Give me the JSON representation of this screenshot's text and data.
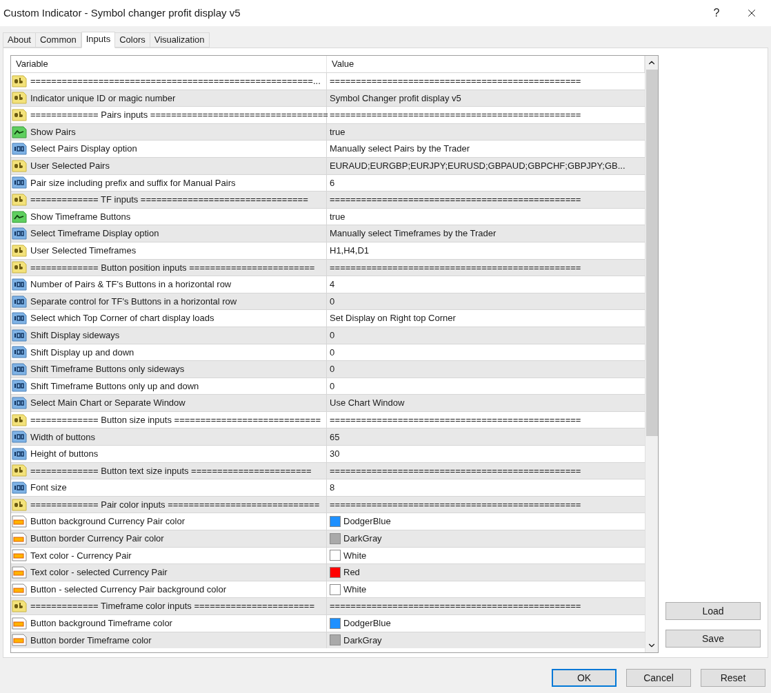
{
  "window": {
    "title": "Custom Indicator - Symbol changer profit display v5",
    "help": "?"
  },
  "tabs": [
    {
      "label": "About",
      "selected": false
    },
    {
      "label": "Common",
      "selected": false
    },
    {
      "label": "Inputs",
      "selected": true
    },
    {
      "label": "Colors",
      "selected": false
    },
    {
      "label": "Visualization",
      "selected": false
    }
  ],
  "table": {
    "columns": [
      "Variable",
      "Value"
    ],
    "rows": [
      {
        "kind": "string",
        "variable": "======================================================...",
        "value": "================================================"
      },
      {
        "kind": "string",
        "variable": "Indicator unique ID or magic number",
        "value": "Symbol Changer profit display v5"
      },
      {
        "kind": "string",
        "variable": "============= Pairs inputs ==================================",
        "value": "================================================"
      },
      {
        "kind": "bool",
        "variable": "Show Pairs",
        "value": "true"
      },
      {
        "kind": "int",
        "variable": "Select Pairs Display option",
        "value": "Manually select Pairs by the Trader"
      },
      {
        "kind": "string",
        "variable": "User Selected Pairs",
        "value": "EURAUD;EURGBP;EURJPY;EURUSD;GBPAUD;GBPCHF;GBPJPY;GB..."
      },
      {
        "kind": "int",
        "variable": "Pair size including prefix and suffix for Manual Pairs",
        "value": "6"
      },
      {
        "kind": "string",
        "variable": "============= TF inputs ================================",
        "value": "================================================"
      },
      {
        "kind": "bool",
        "variable": "Show Timeframe Buttons",
        "value": "true"
      },
      {
        "kind": "int",
        "variable": "Select Timeframe Display option",
        "value": "Manually select Timeframes by the Trader"
      },
      {
        "kind": "string",
        "variable": "User Selected Timeframes",
        "value": "H1,H4,D1"
      },
      {
        "kind": "string",
        "variable": "============= Button position inputs ========================",
        "value": "================================================"
      },
      {
        "kind": "int",
        "variable": "Number of Pairs & TF's Buttons in a horizontal row",
        "value": "4"
      },
      {
        "kind": "int",
        "variable": "Separate control for TF's Buttons in a horizontal row",
        "value": "0"
      },
      {
        "kind": "int",
        "variable": "Select which Top Corner of chart display loads",
        "value": "Set Display on Right top Corner"
      },
      {
        "kind": "int",
        "variable": "Shift Display sideways",
        "value": "0"
      },
      {
        "kind": "int",
        "variable": "Shift Display up and down",
        "value": "0"
      },
      {
        "kind": "int",
        "variable": "Shift Timeframe Buttons only sideways",
        "value": "0"
      },
      {
        "kind": "int",
        "variable": "Shift Timeframe Buttons only up and down",
        "value": "0"
      },
      {
        "kind": "int",
        "variable": "Select Main Chart or Separate Window",
        "value": "Use Chart Window"
      },
      {
        "kind": "string",
        "variable": "============= Button size inputs ============================",
        "value": "================================================"
      },
      {
        "kind": "int",
        "variable": "Width of buttons",
        "value": "65"
      },
      {
        "kind": "int",
        "variable": "Height of buttons",
        "value": "30"
      },
      {
        "kind": "string",
        "variable": "============= Button text size inputs =======================",
        "value": "================================================"
      },
      {
        "kind": "int",
        "variable": "Font size",
        "value": "8"
      },
      {
        "kind": "string",
        "variable": "============= Pair color inputs =============================",
        "value": "================================================"
      },
      {
        "kind": "color",
        "variable": "Button background Currency Pair color",
        "value": "DodgerBlue",
        "color": "#1e90ff"
      },
      {
        "kind": "color",
        "variable": "Button border Currency Pair color",
        "value": "DarkGray",
        "color": "#a9a9a9"
      },
      {
        "kind": "color",
        "variable": "Text color -  Currency Pair",
        "value": "White",
        "color": "#ffffff"
      },
      {
        "kind": "color",
        "variable": "Text color - selected Currency Pair",
        "value": "Red",
        "color": "#ff0000"
      },
      {
        "kind": "color",
        "variable": "Button - selected Currency Pair background color",
        "value": "White",
        "color": "#ffffff"
      },
      {
        "kind": "string",
        "variable": "============= Timeframe color inputs  =======================",
        "value": "================================================"
      },
      {
        "kind": "color",
        "variable": "Button background Timeframe color",
        "value": "DodgerBlue",
        "color": "#1e90ff"
      },
      {
        "kind": "color",
        "variable": "Button border Timeframe color",
        "value": "DarkGray",
        "color": "#a9a9a9"
      }
    ]
  },
  "side_buttons": [
    "Load",
    "Save"
  ],
  "footer_buttons": [
    {
      "label": "OK",
      "default": true
    },
    {
      "label": "Cancel",
      "default": false
    },
    {
      "label": "Reset",
      "default": false
    }
  ]
}
